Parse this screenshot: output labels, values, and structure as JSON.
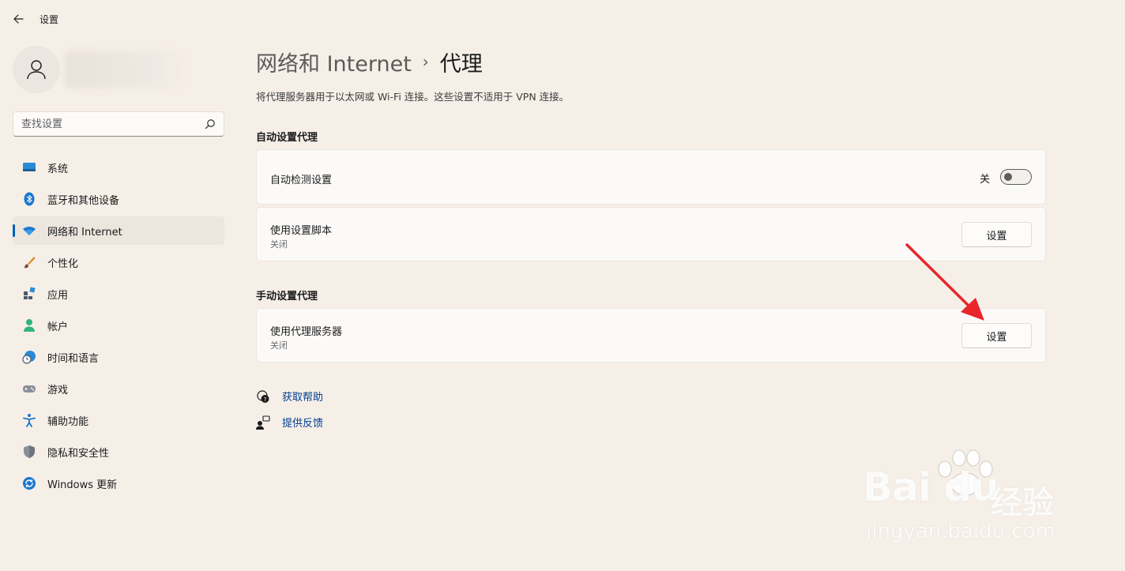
{
  "window": {
    "title": "设置"
  },
  "search": {
    "placeholder": "查找设置"
  },
  "sidebar": {
    "items": [
      {
        "label": "系统",
        "icon": "monitor-icon"
      },
      {
        "label": "蓝牙和其他设备",
        "icon": "bluetooth-icon"
      },
      {
        "label": "网络和 Internet",
        "icon": "wifi-icon",
        "active": true
      },
      {
        "label": "个性化",
        "icon": "brush-icon"
      },
      {
        "label": "应用",
        "icon": "apps-icon"
      },
      {
        "label": "帐户",
        "icon": "account-icon"
      },
      {
        "label": "时间和语言",
        "icon": "globe-clock-icon"
      },
      {
        "label": "游戏",
        "icon": "gamepad-icon"
      },
      {
        "label": "辅助功能",
        "icon": "accessibility-icon"
      },
      {
        "label": "隐私和安全性",
        "icon": "shield-icon"
      },
      {
        "label": "Windows 更新",
        "icon": "sync-icon"
      }
    ]
  },
  "main": {
    "breadcrumb": {
      "parent": "网络和 Internet",
      "separator": "›",
      "current": "代理"
    },
    "description": "将代理服务器用于以太网或 Wi-Fi 连接。这些设置不适用于 VPN 连接。",
    "auto_section": {
      "title": "自动设置代理",
      "detect": {
        "title": "自动检测设置",
        "toggle_state": "关",
        "on": false
      },
      "script": {
        "title": "使用设置脚本",
        "status": "关闭",
        "button": "设置"
      }
    },
    "manual_section": {
      "title": "手动设置代理",
      "proxy": {
        "title": "使用代理服务器",
        "status": "关闭",
        "button": "设置"
      }
    },
    "links": {
      "help": "获取帮助",
      "feedback": "提供反馈"
    }
  },
  "watermark": {
    "brand": "Bai du",
    "brand_cn": "经验",
    "url": "jingyan.baidu.com"
  },
  "colors": {
    "background": "#f6efe8",
    "accent": "#005fb8",
    "annotation_arrow": "#e8262b",
    "link": "#003e92"
  }
}
